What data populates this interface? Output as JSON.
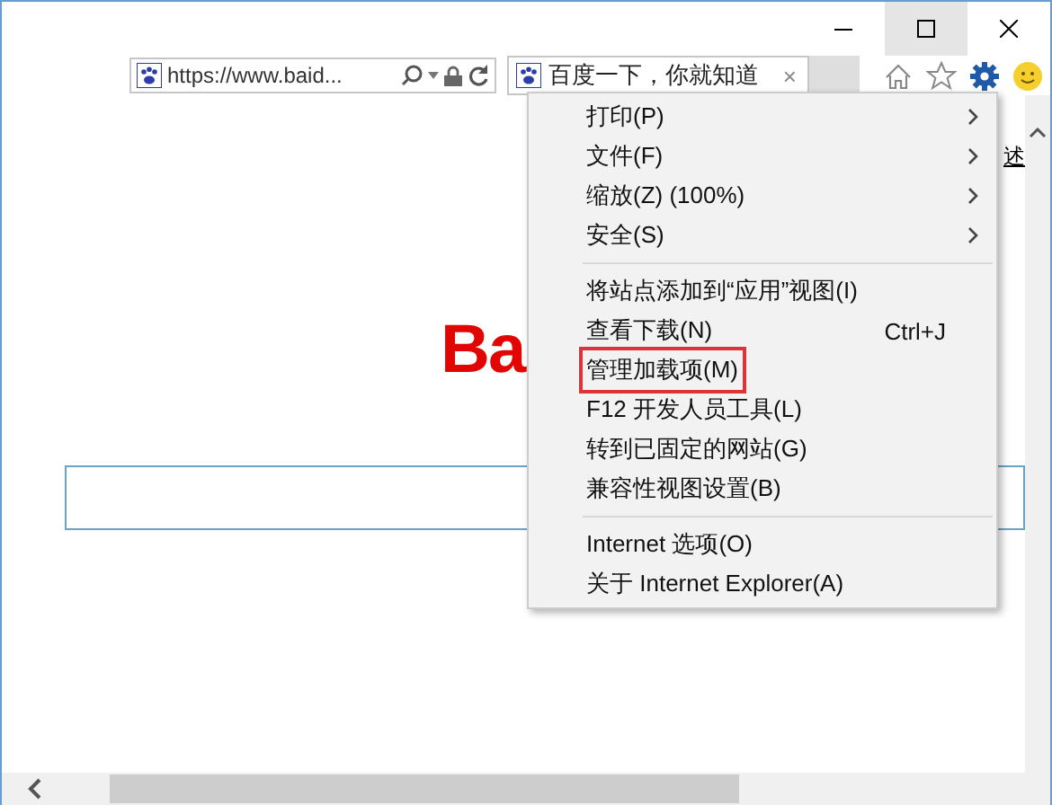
{
  "window": {
    "maximize_hovered": true
  },
  "address_bar": {
    "url": "https://www.baid..."
  },
  "tabs": [
    {
      "title": "百度一下，你就知道",
      "selected": true,
      "close": "×"
    }
  ],
  "page": {
    "logo": "Ba",
    "edge_text": "述"
  },
  "menu": {
    "groups": [
      [
        {
          "label": "打印(P)",
          "submenu": true,
          "annotated": false
        },
        {
          "label": "文件(F)",
          "submenu": true,
          "annotated": false
        },
        {
          "label": "缩放(Z) (100%)",
          "submenu": true,
          "annotated": false
        },
        {
          "label": "安全(S)",
          "submenu": true,
          "annotated": false
        }
      ],
      [
        {
          "label": "将站点添加到“应用”视图(I)",
          "submenu": false,
          "annotated": false
        },
        {
          "label": "查看下载(N)",
          "shortcut": "Ctrl+J",
          "submenu": false,
          "annotated": false
        },
        {
          "label": "管理加载项(M)",
          "submenu": false,
          "annotated": true
        },
        {
          "label": "F12 开发人员工具(L)",
          "submenu": false,
          "annotated": false
        },
        {
          "label": "转到已固定的网站(G)",
          "submenu": false,
          "annotated": false
        },
        {
          "label": "兼容性视图设置(B)",
          "submenu": false,
          "annotated": false
        }
      ],
      [
        {
          "label": "Internet 选项(O)",
          "submenu": false,
          "annotated": false
        },
        {
          "label": "关于 Internet Explorer(A)",
          "submenu": false,
          "annotated": false
        }
      ]
    ]
  }
}
